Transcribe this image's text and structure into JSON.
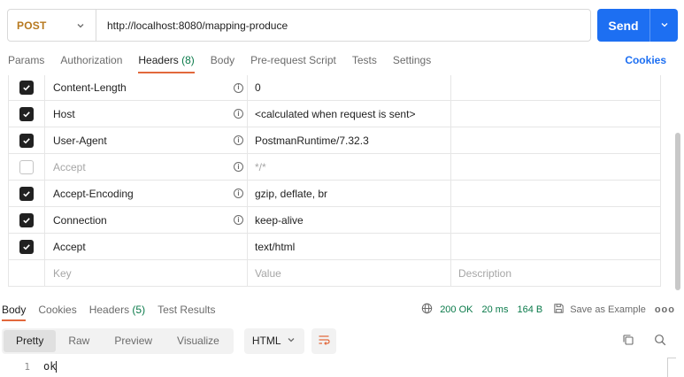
{
  "request": {
    "method": "POST",
    "url": "http://localhost:8080/mapping-produce",
    "send_label": "Send"
  },
  "request_tabs": [
    {
      "label": "Params"
    },
    {
      "label": "Authorization"
    },
    {
      "label": "Headers",
      "count": "(8)"
    },
    {
      "label": "Body"
    },
    {
      "label": "Pre-request Script"
    },
    {
      "label": "Tests"
    },
    {
      "label": "Settings"
    }
  ],
  "cookies_link": "Cookies",
  "headers": [
    {
      "key": "Content-Length",
      "value": "0",
      "checked": true,
      "info": true
    },
    {
      "key": "Host",
      "value": "<calculated when request is sent>",
      "checked": true,
      "info": true
    },
    {
      "key": "User-Agent",
      "value": "PostmanRuntime/7.32.3",
      "checked": true,
      "info": true
    },
    {
      "key": "Accept",
      "value": "*/*",
      "checked": false,
      "info": true
    },
    {
      "key": "Accept-Encoding",
      "value": "gzip, deflate, br",
      "checked": true,
      "info": true
    },
    {
      "key": "Connection",
      "value": "keep-alive",
      "checked": true,
      "info": true
    },
    {
      "key": "Accept",
      "value": "text/html",
      "checked": true,
      "info": false
    }
  ],
  "new_row": {
    "key": "Key",
    "value": "Value",
    "description": "Description"
  },
  "response": {
    "tabs": [
      {
        "label": "Body"
      },
      {
        "label": "Cookies"
      },
      {
        "label": "Headers",
        "count": "(5)"
      },
      {
        "label": "Test Results"
      }
    ],
    "status": "200 OK",
    "time": "20 ms",
    "size": "164 B",
    "save_example": "Save as Example",
    "more": "ooo",
    "views": [
      "Pretty",
      "Raw",
      "Preview",
      "Visualize"
    ],
    "format": "HTML",
    "body_lines": [
      {
        "no": "1",
        "text": "ok"
      }
    ]
  },
  "colors": {
    "accent": "#1d6ff2",
    "tab_underline": "#e2683c",
    "success": "#0a7a4a",
    "method": "#b7791f"
  }
}
